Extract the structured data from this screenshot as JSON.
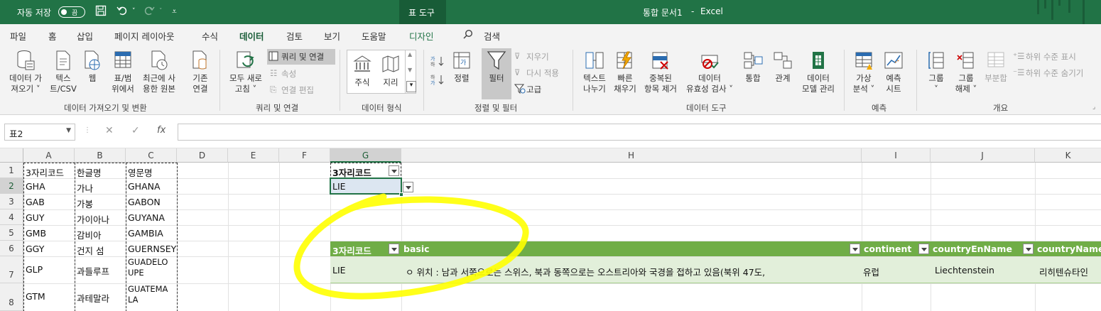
{
  "titlebar": {
    "autosave_label": "자동 저장",
    "autosave_state": "끔",
    "context_tab": "표 도구",
    "document_title": "통합 문서1",
    "separator": "-",
    "app_name": "Excel",
    "icons": [
      "save-icon",
      "undo-icon",
      "redo-icon",
      "customize-qat-icon"
    ]
  },
  "menu": {
    "tabs": [
      "파일",
      "홈",
      "삽입",
      "페이지 레이아웃",
      "수식",
      "데이터",
      "검토",
      "보기",
      "도움말",
      "디자인"
    ],
    "active_tab": "데이터",
    "search_label": "검색"
  },
  "ribbon": {
    "get_data_group": {
      "label": "데이터 가져오기 및 변환",
      "buttons": [
        {
          "line1": "데이터 가",
          "line2": "져오기 ˅"
        },
        {
          "line1": "텍스",
          "line2": "트/CSV"
        },
        {
          "line1": "웹",
          "line2": ""
        },
        {
          "line1": "표/범",
          "line2": "위에서"
        },
        {
          "line1": "최근에 사",
          "line2": "용한 원본"
        },
        {
          "line1": "기존",
          "line2": "연결"
        }
      ]
    },
    "queries_group": {
      "label": "쿼리 및 연결",
      "refresh": {
        "line1": "모두 새로",
        "line2": "고침 ˅"
      },
      "queries_connections": "쿼리 및 연결",
      "properties": "속성",
      "edit_links": "연결 편집"
    },
    "data_types_group": {
      "label": "데이터 형식",
      "stocks": "주식",
      "geography": "지리"
    },
    "sort_filter_group": {
      "label": "정렬 및 필터",
      "sort": "정렬",
      "filter": "필터",
      "clear": "지우기",
      "reapply": "다시 적용",
      "advanced": "고급"
    },
    "data_tools_group": {
      "label": "데이터 도구",
      "buttons": [
        {
          "line1": "텍스트",
          "line2": "나누기"
        },
        {
          "line1": "빠른",
          "line2": "채우기"
        },
        {
          "line1": "중복된",
          "line2": "항목 제거"
        },
        {
          "line1": "데이터",
          "line2": "유효성 검사 ˅"
        },
        {
          "line1": "통합",
          "line2": ""
        },
        {
          "line1": "관계",
          "line2": ""
        },
        {
          "line1": "데이터",
          "line2": "모델 관리"
        }
      ]
    },
    "forecast_group": {
      "label": "예측",
      "what_if": {
        "line1": "가상",
        "line2": "분석 ˅"
      },
      "forecast_sheet": {
        "line1": "예측",
        "line2": "시트"
      }
    },
    "outline_group": {
      "label": "개요",
      "group": {
        "line1": "그룹",
        "line2": "˅"
      },
      "ungroup": {
        "line1": "그룹",
        "line2": "해제 ˅"
      },
      "subtotal": "부분합",
      "show_detail": "하위 수준 표시",
      "hide_detail": "하위 수준 숨기기"
    }
  },
  "formula_bar": {
    "name_box": "표2",
    "cancel": "✕",
    "enter": "✓",
    "fx": "fx",
    "value": ""
  },
  "sheet": {
    "columns": [
      "A",
      "B",
      "C",
      "D",
      "E",
      "F",
      "G",
      "H",
      "I",
      "J",
      "K"
    ],
    "rows": [
      "1",
      "2",
      "3",
      "4",
      "5",
      "6",
      "7",
      "8"
    ],
    "selected_column": "G",
    "selected_row": "2",
    "left_table": [
      [
        "3자리코드",
        "한글명",
        "영문명"
      ],
      [
        "GHA",
        "가나",
        "GHANA"
      ],
      [
        "GAB",
        "가봉",
        "GABON"
      ],
      [
        "GUY",
        "가이아나",
        "GUYANA"
      ],
      [
        "GMB",
        "감비아",
        "GAMBIA"
      ],
      [
        "GGY",
        "건지 섬",
        "GUERNSEY"
      ],
      [
        "GLP",
        "과들루프",
        "GUADELOUPE"
      ],
      [
        "GTM",
        "과테말라",
        "GUATEMALA"
      ]
    ],
    "lookup": {
      "header": "3자리코드",
      "value": "LIE"
    },
    "result_table": {
      "headers": [
        "3자리코드",
        "basic",
        "continent",
        "countryEnName",
        "countryName"
      ],
      "row": [
        "LIE",
        "ㅇ 위치 : 남과 서쪽으로는 스위스, 북과 동쪽으로는 오스트리아와 국경을 접하고 있음(북위 47도,",
        "유럽",
        "Liechtenstein",
        "리히텐슈타인"
      ]
    },
    "colors": {
      "header_green": "#70ad47",
      "band_light": "#e2efda",
      "annotation": "#ffff00",
      "excel_green": "#217346"
    }
  }
}
